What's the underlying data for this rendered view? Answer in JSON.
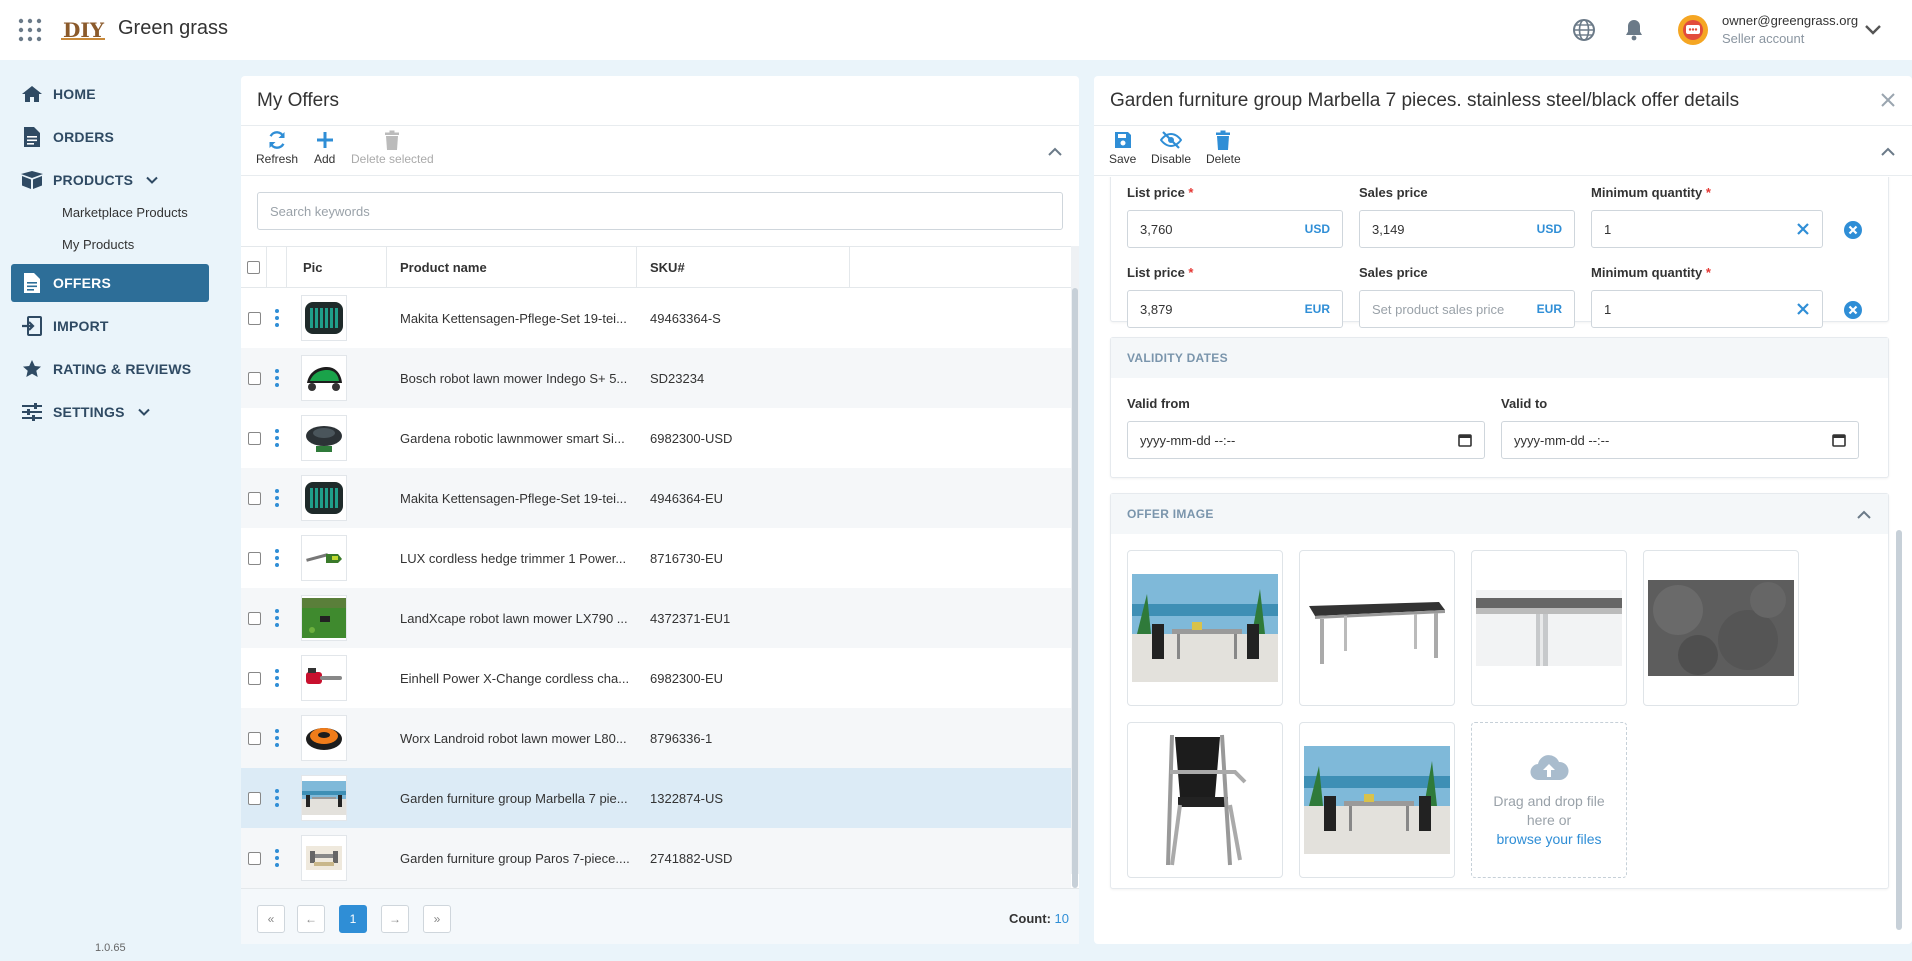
{
  "header": {
    "app_name": "Green grass",
    "logo_text": "DIY",
    "user_email": "owner@greengrass.org",
    "user_role": "Seller account"
  },
  "sidebar": {
    "items": [
      {
        "label": "HOME",
        "icon": "home-icon"
      },
      {
        "label": "ORDERS",
        "icon": "document-icon"
      },
      {
        "label": "PRODUCTS",
        "icon": "box-icon",
        "expanded": true
      },
      {
        "label": "OFFERS",
        "icon": "document-icon",
        "active": true
      },
      {
        "label": "IMPORT",
        "icon": "import-icon"
      },
      {
        "label": "RATING & REVIEWS",
        "icon": "star-icon"
      },
      {
        "label": "SETTINGS",
        "icon": "sliders-icon",
        "expandable": true
      }
    ],
    "products_sub": [
      "Marketplace Products",
      "My Products"
    ],
    "version": "1.0.65"
  },
  "offers": {
    "title": "My Offers",
    "toolbar": {
      "refresh": "Refresh",
      "add": "Add",
      "delete": "Delete selected"
    },
    "search_placeholder": "Search keywords",
    "columns": [
      "Pic",
      "Product name",
      "SKU#"
    ],
    "rows": [
      {
        "name": "Makita Kettensagen-Pflege-Set 19-tei...",
        "sku": "49463364-S",
        "pic": "tool-case"
      },
      {
        "name": "Bosch robot lawn mower Indego S+ 5...",
        "sku": "SD23234",
        "pic": "mower-green"
      },
      {
        "name": "Gardena robotic lawnmower smart Si...",
        "sku": "6982300-USD",
        "pic": "mower-dark"
      },
      {
        "name": "Makita Kettensagen-Pflege-Set 19-tei...",
        "sku": "4946364-EU",
        "pic": "tool-case"
      },
      {
        "name": "LUX cordless hedge trimmer 1 Power...",
        "sku": "8716730-EU",
        "pic": "trimmer"
      },
      {
        "name": "LandXcape robot lawn mower LX790 ...",
        "sku": "4372371-EU1",
        "pic": "lawn"
      },
      {
        "name": "Einhell Power X-Change cordless cha...",
        "sku": "6982300-EU",
        "pic": "chainsaw"
      },
      {
        "name": "Worx Landroid robot lawn mower L80...",
        "sku": "8796336-1",
        "pic": "mower-orange"
      },
      {
        "name": "Garden furniture group Marbella 7 pie...",
        "sku": "1322874-US",
        "pic": "patio",
        "selected": true
      },
      {
        "name": "Garden furniture group Paros 7-piece....",
        "sku": "2741882-USD",
        "pic": "patio-small"
      }
    ],
    "pager": {
      "first": "«",
      "prev": "←",
      "current": "1",
      "next": "→",
      "last": "»"
    },
    "count_label": "Count:",
    "count_value": "10"
  },
  "details": {
    "title": "Garden furniture group Marbella 7 pieces. stainless steel/black offer details",
    "toolbar": {
      "save": "Save",
      "disable": "Disable",
      "delete": "Delete"
    },
    "prices": [
      {
        "list_label": "List price",
        "list_value": "3,760",
        "currency": "USD",
        "sales_label": "Sales price",
        "sales_value": "3,149",
        "sales_placeholder": "",
        "min_label": "Minimum quantity",
        "min_value": "1"
      },
      {
        "list_label": "List price",
        "list_value": "3,879",
        "currency": "EUR",
        "sales_label": "Sales price",
        "sales_value": "",
        "sales_placeholder": "Set product sales price",
        "min_label": "Minimum quantity",
        "min_value": "1"
      }
    ],
    "validity": {
      "heading": "VALIDITY DATES",
      "from_label": "Valid from",
      "to_label": "Valid to",
      "from_value": "yyyy-mm-dd --:--",
      "to_value": "yyyy-mm-dd --:--"
    },
    "image_section": {
      "heading": "OFFER IMAGE",
      "drop_line1": "Drag and drop file",
      "drop_line2": "here or",
      "browse": "browse your files"
    }
  }
}
